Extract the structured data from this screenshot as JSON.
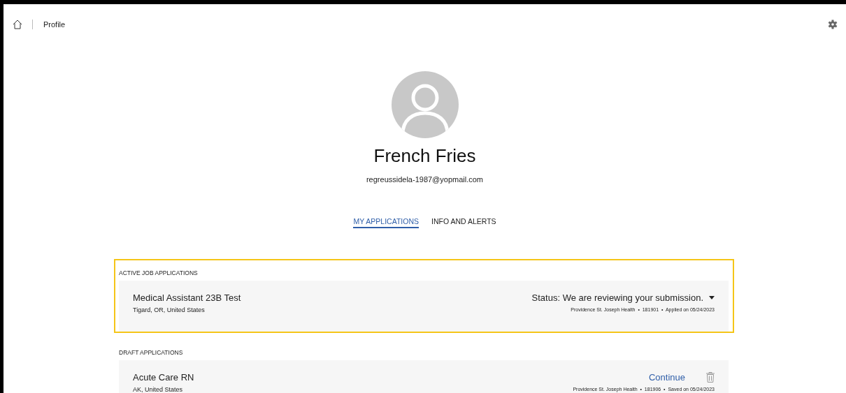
{
  "breadcrumb": {
    "label": "Profile"
  },
  "profile": {
    "name": "French Fries",
    "email": "regreussidela-1987@yopmail.com"
  },
  "tabs": [
    {
      "label": "MY APPLICATIONS",
      "selected": true
    },
    {
      "label": "INFO AND ALERTS",
      "selected": false
    }
  ],
  "sections": [
    {
      "title": "ACTIVE JOB APPLICATIONS",
      "highlighted": true,
      "applications": [
        {
          "kind": "active",
          "title": "Medical Assistant 23B Test",
          "location": "Tigard, OR, United States",
          "status": "Status: We are reviewing your submission.",
          "meta": "Providence St. Joseph Health  •  181901  •  Applied on 05/24/2023"
        }
      ]
    },
    {
      "title": "DRAFT APPLICATIONS",
      "highlighted": false,
      "applications": [
        {
          "kind": "draft",
          "title": "Acute Care RN",
          "location": "AK, United States",
          "action": "Continue",
          "meta": "Providence St. Joseph Health  •  181906  •  Saved on 05/24/2023"
        }
      ]
    }
  ]
}
